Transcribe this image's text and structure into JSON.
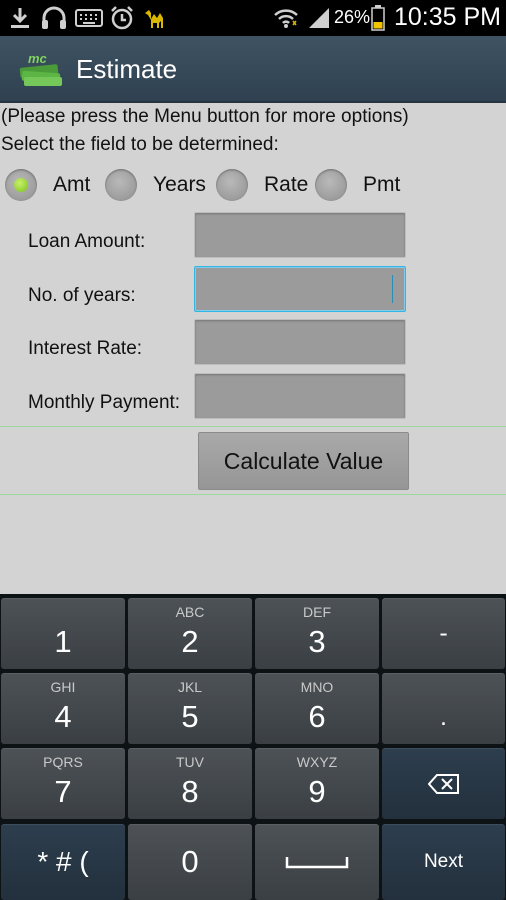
{
  "status_bar": {
    "icons": [
      "download-icon",
      "headset-icon",
      "keyboard-icon",
      "alarm-icon",
      "camel-icon",
      "wifi-icon",
      "signal-icon",
      "battery-icon"
    ],
    "battery_percent": "26%",
    "time": "10:35 PM"
  },
  "action_bar": {
    "logo_text": "mc",
    "title": "Estimate"
  },
  "hint": "(Please press the Menu button for more options)",
  "select_label": "Select the field to be determined:",
  "radios": [
    {
      "label": "Amt",
      "selected": true
    },
    {
      "label": "Years",
      "selected": false
    },
    {
      "label": "Rate",
      "selected": false
    },
    {
      "label": "Pmt",
      "selected": false
    }
  ],
  "fields": [
    {
      "label": "Loan Amount:",
      "value": ""
    },
    {
      "label": "No. of years:",
      "value": "",
      "focused": true
    },
    {
      "label": "Interest Rate:",
      "value": ""
    },
    {
      "label": "Monthly Payment:",
      "value": ""
    }
  ],
  "calculate_button": "Calculate Value",
  "keyboard": {
    "rows": [
      [
        {
          "main": "1",
          "sub": ""
        },
        {
          "main": "2",
          "sub": "ABC"
        },
        {
          "main": "3",
          "sub": "DEF"
        },
        {
          "main": "-",
          "sub": ""
        }
      ],
      [
        {
          "main": "4",
          "sub": "GHI"
        },
        {
          "main": "5",
          "sub": "JKL"
        },
        {
          "main": "6",
          "sub": "MNO"
        },
        {
          "main": ".",
          "sub": ""
        }
      ],
      [
        {
          "main": "7",
          "sub": "PQRS"
        },
        {
          "main": "8",
          "sub": "TUV"
        },
        {
          "main": "9",
          "sub": "WXYZ"
        },
        {
          "main": "",
          "sub": "",
          "icon": "backspace-icon"
        }
      ],
      [
        {
          "main": "* # (",
          "sub": ""
        },
        {
          "main": "0",
          "sub": ""
        },
        {
          "main": "",
          "sub": "",
          "icon": "space-icon"
        },
        {
          "main": "Next",
          "sub": ""
        }
      ]
    ]
  }
}
